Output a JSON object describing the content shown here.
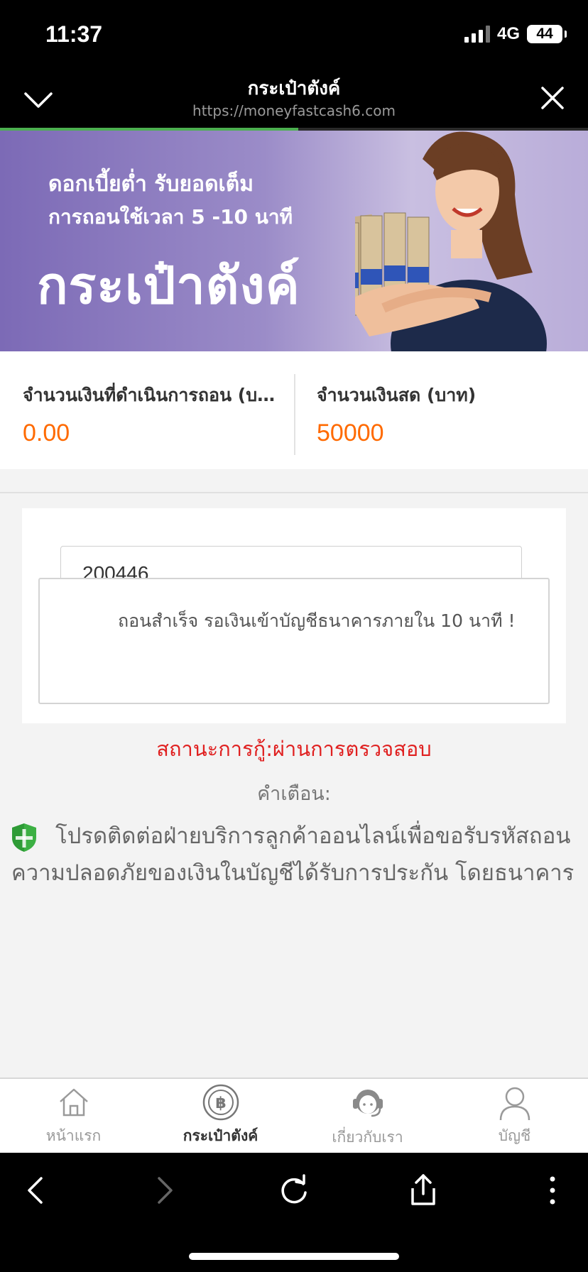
{
  "status_bar": {
    "time": "11:37",
    "network": "4G",
    "battery": "44"
  },
  "browser": {
    "title": "กระเป๋าตังค์",
    "url": "https://moneyfastcash6.com",
    "load_progress": 0.507
  },
  "banner": {
    "line1": "ดอกเบี้ยต่ำ รับยอดเต็ม",
    "line2": "การถอนใช้เวลา 5 -10 นาที",
    "title": "กระเป๋าตังค์"
  },
  "summary": {
    "withdraw_label": "จำนวนเงินที่ดำเนินการถอน (บาท)",
    "withdraw_value": "0.00",
    "cash_label": "จำนวนเงินสด (บาท)",
    "cash_value": "50000"
  },
  "form": {
    "code_value": "200446",
    "toast_message": "ถอนสำเร็จ รอเงินเข้าบัญชีธนาคารภายใน 10 นาที !"
  },
  "loan_status": "สถานะการกู้:ผ่านการตรวจสอบ",
  "warning": {
    "title": "คำเตือน:",
    "body": "โปรดติดต่อฝ่ายบริการลูกค้าออนไลน์เพื่อขอรับรหัสถอน ความปลอดภัยของเงินในบัญชีได้รับการประกัน โดยธนาคาร"
  },
  "tabs": [
    {
      "label": "หน้าแรก",
      "icon": "home-icon"
    },
    {
      "label": "กระเป๋าตังค์",
      "icon": "baht-coin-icon",
      "active": true
    },
    {
      "label": "เกี่ยวกับเรา",
      "icon": "support-agent-icon"
    },
    {
      "label": "บัญชี",
      "icon": "user-icon"
    }
  ],
  "colors": {
    "accent": "#ff6a00",
    "status_red": "#e02020",
    "shield_green": "#3cb043",
    "progress_green": "#4caf50"
  }
}
